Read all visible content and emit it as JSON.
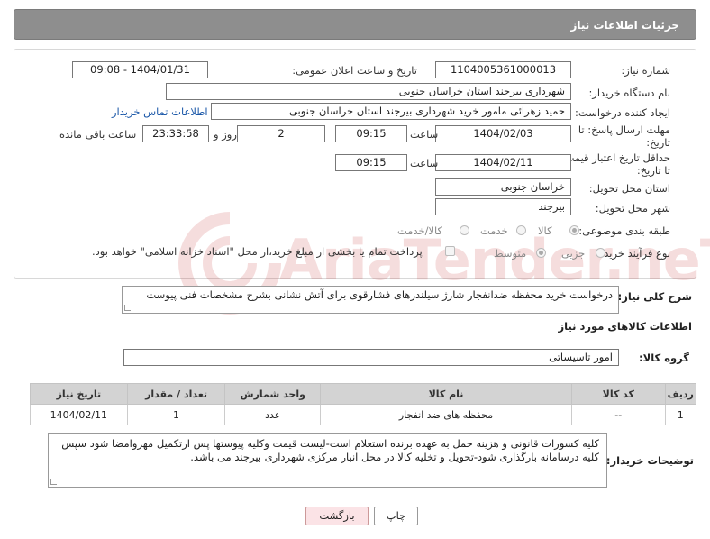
{
  "header": {
    "title": "جزئیات اطلاعات نیاز"
  },
  "form": {
    "need_number": {
      "label": "شماره نیاز:",
      "value": "1104005361000013"
    },
    "announce": {
      "label": "تاریخ و ساعت اعلان عمومی:",
      "value": "1404/01/31 - 09:08"
    },
    "buyer_org": {
      "label": "نام دستگاه خریدار:",
      "value": "شهرداری بیرجند استان خراسان جنوبی"
    },
    "requester": {
      "label": "ایجاد کننده درخواست:",
      "value": "حمید زهرائی مامور خرید شهرداری بیرجند استان خراسان جنوبی",
      "contact_link": "اطلاعات تماس خریدار"
    },
    "reply_deadline": {
      "label_line1": "مهلت ارسال پاسخ: تا",
      "label_line2": "تاریخ:",
      "date": "1404/02/03",
      "time_label": "ساعت",
      "time": "09:15",
      "days": "2",
      "days_label": "روز و",
      "remaining": "23:33:58",
      "remaining_label": "ساعت باقی مانده"
    },
    "price_validity": {
      "label_line1": "حداقل تاریخ اعتبار قیمت:",
      "label_line2": "تا تاریخ:",
      "date": "1404/02/11",
      "time_label": "ساعت",
      "time": "09:15"
    },
    "delivery_province": {
      "label": "استان محل تحویل:",
      "value": "خراسان جنوبی"
    },
    "delivery_city": {
      "label": "شهر محل تحویل:",
      "value": "بیرجند"
    },
    "category": {
      "label": "طبقه بندی موضوعی:",
      "options": [
        "کالا",
        "خدمت",
        "کالا/خدمت"
      ],
      "selected": "کالا"
    },
    "purchase_process": {
      "label": "نوع فرآیند خرید :",
      "options": [
        "جزیی",
        "متوسط"
      ],
      "selected": "متوسط",
      "payment_note": "پرداخت تمام یا بخشی از مبلغ خرید،از محل \"اسناد خزانه اسلامی\" خواهد بود."
    }
  },
  "watermark": {
    "text": "AriaTender.neT"
  },
  "description": {
    "label": "شرح کلی نیاز:",
    "value": "درخواست خرید محفظه ضدانفجار شارژ سیلندرهای فشارقوی برای آتش نشانی بشرح مشخصات فنی پیوست"
  },
  "goods_section": {
    "title": "اطلاعات کالاهای مورد نیاز",
    "group_label": "گروه کالا:",
    "group_value": "امور تاسیساتی"
  },
  "table": {
    "headers": [
      "ردیف",
      "کد کالا",
      "نام کالا",
      "واحد شمارش",
      "تعداد / مقدار",
      "تاریخ نیاز"
    ],
    "rows": [
      [
        "1",
        "--",
        "محفظه های ضد انفجار",
        "عدد",
        "1",
        "1404/02/11"
      ]
    ]
  },
  "buyer_notes": {
    "label": "توضیحات خریدار:",
    "value": "کلیه کسورات قانونی و هزینه حمل به عهده برنده استعلام است-لیست قیمت وکلیه پیوستها پس ازتکمیل مهروامضا شود سپس کلیه درسامانه بارگذاری شود-تحویل و تخلیه کالا در محل انبار مرکزی شهرداری بیرجند می باشد."
  },
  "buttons": {
    "print": "چاپ",
    "back": "بازگشت"
  }
}
